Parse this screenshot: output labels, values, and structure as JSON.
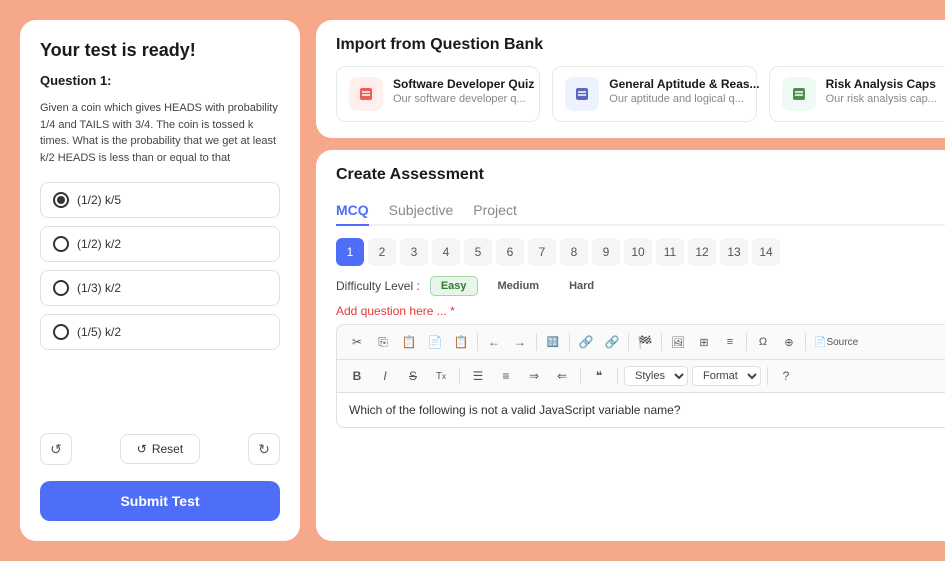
{
  "left": {
    "title": "Your test is ready!",
    "question_label": "Question 1:",
    "question_text": "Given a coin which gives HEADS with probability 1/4 and TAILS with 3/4. The coin is tossed k times. What is the probability that we get at least k/2 HEADS is less than or equal to that",
    "options": [
      {
        "label": "(1/2) k/5",
        "selected": true
      },
      {
        "label": "(1/2) k/2",
        "selected": false
      },
      {
        "label": "(1/3) k/2",
        "selected": false
      },
      {
        "label": "(1/5) k/2",
        "selected": false
      }
    ],
    "reset_label": "Reset",
    "submit_label": "Submit Test"
  },
  "import": {
    "title": "Import from Question Bank",
    "cards": [
      {
        "id": "card-1",
        "icon": "📋",
        "icon_class": "red",
        "title": "Software Developer Quiz",
        "desc": "Our software developer q..."
      },
      {
        "id": "card-2",
        "icon": "📘",
        "icon_class": "blue",
        "title": "General Aptitude & Reas...",
        "desc": "Our aptitude and logical q..."
      },
      {
        "id": "card-3",
        "icon": "📗",
        "icon_class": "green",
        "title": "Risk Analysis Caps",
        "desc": "Our risk analysis cap..."
      }
    ]
  },
  "create": {
    "title": "Create Assessment",
    "tabs": [
      {
        "label": "MCQ",
        "active": true
      },
      {
        "label": "Subjective",
        "active": false
      },
      {
        "label": "Project",
        "active": false
      }
    ],
    "question_numbers": [
      1,
      2,
      3,
      4,
      5,
      6,
      7,
      8,
      9,
      10,
      11,
      12,
      13,
      14
    ],
    "active_question": 1,
    "difficulty": {
      "label": "Difficulty Level :",
      "options": [
        "Easy",
        "Medium",
        "Hard"
      ],
      "active": "Easy"
    },
    "add_question_placeholder": "Add question here ... ",
    "add_question_required": "*",
    "toolbar_row1": [
      "✂",
      "📋",
      "📄",
      "📋",
      "📋",
      "←",
      "→",
      "🔠",
      "🔗",
      "🔗",
      "🏁",
      "🖼",
      "⊞",
      "≡",
      "Ω",
      "⊕",
      "📄"
    ],
    "source_label": "Source",
    "toolbar_row2_btns": [
      "B",
      "I",
      "S",
      "Tx",
      "≡",
      "≡",
      "⇒",
      "⇒",
      "❝",
      "?"
    ],
    "styles_label": "Styles",
    "format_label": "Format",
    "help_label": "?",
    "editor_content": "Which of the following is not a valid JavaScript variable name?"
  }
}
